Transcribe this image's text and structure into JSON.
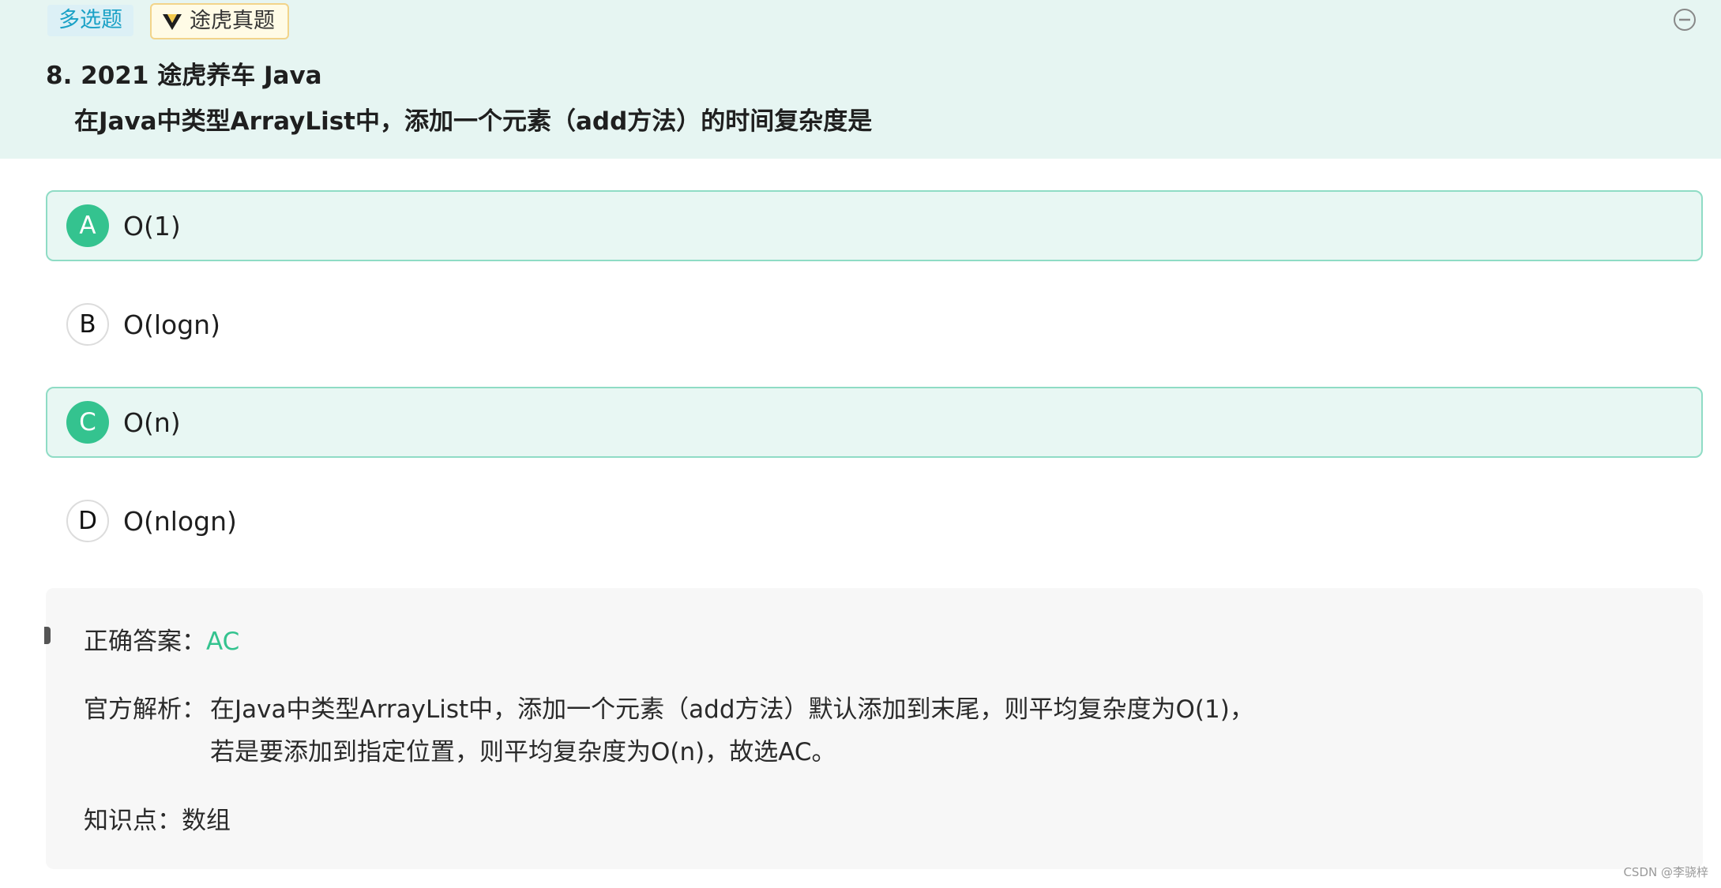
{
  "header": {
    "type_tag": "多选题",
    "source_tag": "途虎真题",
    "question_title": "8. 2021 途虎养车 Java",
    "question_text": "在Java中类型ArrayList中，添加一个元素（add方法）的时间复杂度是"
  },
  "options": [
    {
      "letter": "A",
      "text": "O(1)",
      "selected": true
    },
    {
      "letter": "B",
      "text": "O(logn)",
      "selected": false
    },
    {
      "letter": "C",
      "text": "O(n)",
      "selected": true
    },
    {
      "letter": "D",
      "text": "O(nlogn)",
      "selected": false
    }
  ],
  "answer": {
    "correct_label": "正确答案：",
    "correct_value": "AC",
    "explanation_label": "官方解析：",
    "explanation_line1": "在Java中类型ArrayList中，添加一个元素（add方法）默认添加到末尾，则平均复杂度为O(1)，",
    "explanation_line2": "若是要添加到指定位置，则平均复杂度为O(n)，故选AC。",
    "knowledge_label": "知识点：",
    "knowledge_value": "数组"
  },
  "watermark": "CSDN @李骁梓",
  "colors": {
    "accent": "#34c38f",
    "header_bg": "#e6f5f2",
    "type_tag_text": "#1aa1c6"
  },
  "icons": {
    "collapse": "minus-circle-icon",
    "source_logo": "tuhu-logo-icon"
  }
}
